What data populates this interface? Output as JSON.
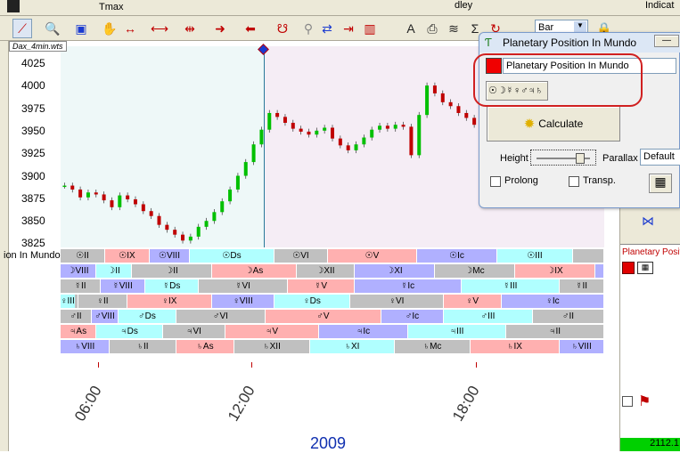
{
  "topbar": {
    "tmax_label": "Tmax",
    "dley_label": "dley",
    "bar_select": "Bar",
    "indicat_label": "Indicat"
  },
  "chart": {
    "file_label": "Dax_4min.wts",
    "y_ticks": [
      "4025",
      "4000",
      "3975",
      "3950",
      "3925",
      "3900",
      "3875",
      "3850",
      "3825"
    ],
    "x_labels": [
      "06:00",
      "12:00",
      "18:00"
    ],
    "year": "2009",
    "band_label": "ion In Mundo"
  },
  "bands": [
    [
      [
        "☉II",
        "#c0c0c0"
      ],
      [
        "☉IX",
        "#ffb0b0"
      ],
      [
        "☉VIII",
        "#b0b0ff"
      ],
      [
        "☉Ds",
        "#b0ffff"
      ],
      [
        "☉VI",
        "#c0c0c0"
      ],
      [
        "☉V",
        "#ffb0b0"
      ],
      [
        "☉Ic",
        "#b0b0ff"
      ],
      [
        "☉III",
        "#b0ffff"
      ],
      [
        "",
        "#c0c0c0"
      ]
    ],
    [
      [
        "☽VIII",
        "#b0b0ff"
      ],
      [
        "☽II",
        "#b0ffff"
      ],
      [
        "☽II",
        "#c0c0c0"
      ],
      [
        "☽As",
        "#ffb0b0"
      ],
      [
        "☽XII",
        "#c0c0c0"
      ],
      [
        "☽XI",
        "#b0b0ff"
      ],
      [
        "☽Mc",
        "#c0c0c0"
      ],
      [
        "☽IX",
        "#ffb0b0"
      ],
      [
        "",
        "#b0b0ff"
      ]
    ],
    [
      [
        "☿II",
        "#c0c0c0"
      ],
      [
        "☿VIII",
        "#b0b0ff"
      ],
      [
        "☿Ds",
        "#b0ffff"
      ],
      [
        "☿VI",
        "#c0c0c0"
      ],
      [
        "☿V",
        "#ffb0b0"
      ],
      [
        "☿Ic",
        "#b0b0ff"
      ],
      [
        "☿III",
        "#b0ffff"
      ],
      [
        "☿II",
        "#c0c0c0"
      ]
    ],
    [
      [
        "♀II",
        "#c0c0c0"
      ],
      [
        "♀II",
        "#c0c0c0"
      ],
      [
        "♀IX",
        "#ffb0b0"
      ],
      [
        "♀VIII",
        "#b0b0ff"
      ],
      [
        "♀Ds",
        "#b0ffff"
      ],
      [
        "♀VI",
        "#c0c0c0"
      ],
      [
        "♀V",
        "#ffb0b0"
      ],
      [
        "♀Ic",
        "#b0b0ff"
      ],
      [
        "♀III",
        "#b0ffff"
      ]
    ],
    [
      [
        "♂II",
        "#c0c0c0"
      ],
      [
        "♂VIII",
        "#b0b0ff"
      ],
      [
        "♂Ds",
        "#b0ffff"
      ],
      [
        "♂VI",
        "#c0c0c0"
      ],
      [
        "♂V",
        "#ffb0b0"
      ],
      [
        "♂Ic",
        "#b0b0ff"
      ],
      [
        "♂III",
        "#b0ffff"
      ],
      [
        "♂II",
        "#c0c0c0"
      ]
    ],
    [
      [
        "♃As",
        "#ffb0b0"
      ],
      [
        "♃Ds",
        "#b0ffff"
      ],
      [
        "♃VI",
        "#c0c0c0"
      ],
      [
        "♃V",
        "#ffb0b0"
      ],
      [
        "♃Ic",
        "#b0b0ff"
      ],
      [
        "♃III",
        "#b0ffff"
      ],
      [
        "♃II",
        "#c0c0c0"
      ]
    ],
    [
      [
        "♄VIII",
        "#b0b0ff"
      ],
      [
        "♄II",
        "#c0c0c0"
      ],
      [
        "♄As",
        "#ffb0b0"
      ],
      [
        "♄XII",
        "#c0c0c0"
      ],
      [
        "♄XI",
        "#b0ffff"
      ],
      [
        "♄Mc",
        "#c0c0c0"
      ],
      [
        "♄IX",
        "#ffb0b0"
      ],
      [
        "♄VIII",
        "#b0b0ff"
      ]
    ]
  ],
  "chart_data": {
    "type": "candlestick",
    "ylim": [
      3825,
      4030
    ],
    "close_series": [
      3888,
      3884,
      3876,
      3881,
      3879,
      3873,
      3866,
      3878,
      3874,
      3869,
      3862,
      3857,
      3848,
      3843,
      3838,
      3832,
      3836,
      3846,
      3852,
      3861,
      3872,
      3884,
      3898,
      3912,
      3930,
      3945,
      3962,
      3958,
      3952,
      3946,
      3943,
      3940,
      3944,
      3947,
      3936,
      3929,
      3924,
      3930,
      3937,
      3945,
      3949,
      3946,
      3950,
      3948,
      3919,
      3960,
      3990,
      3982,
      3973,
      3969,
      3962,
      3957,
      3950,
      3944,
      3937,
      3923,
      3910,
      3906,
      3914,
      3922,
      3934,
      3928,
      3917,
      3907,
      3903,
      3900,
      3910,
      3906,
      3902
    ]
  },
  "dialog": {
    "title": "Planetary Position In Mundo",
    "name_value": "Planetary Position In Mundo",
    "planets": "☉☽☿♀♂♃♄",
    "calculate_label": "Calculate",
    "height_label": "Height",
    "parallax_label": "Parallax",
    "parallax_value": "Default",
    "prolong_label": "Prolong",
    "transp_label": "Transp."
  },
  "rightpanel": {
    "item_label": "Planetary Position In Mundo",
    "status_value": "2112.1"
  },
  "colors": {
    "bull": "#00c000",
    "bear": "#c00000",
    "annotation": "#d02020"
  }
}
